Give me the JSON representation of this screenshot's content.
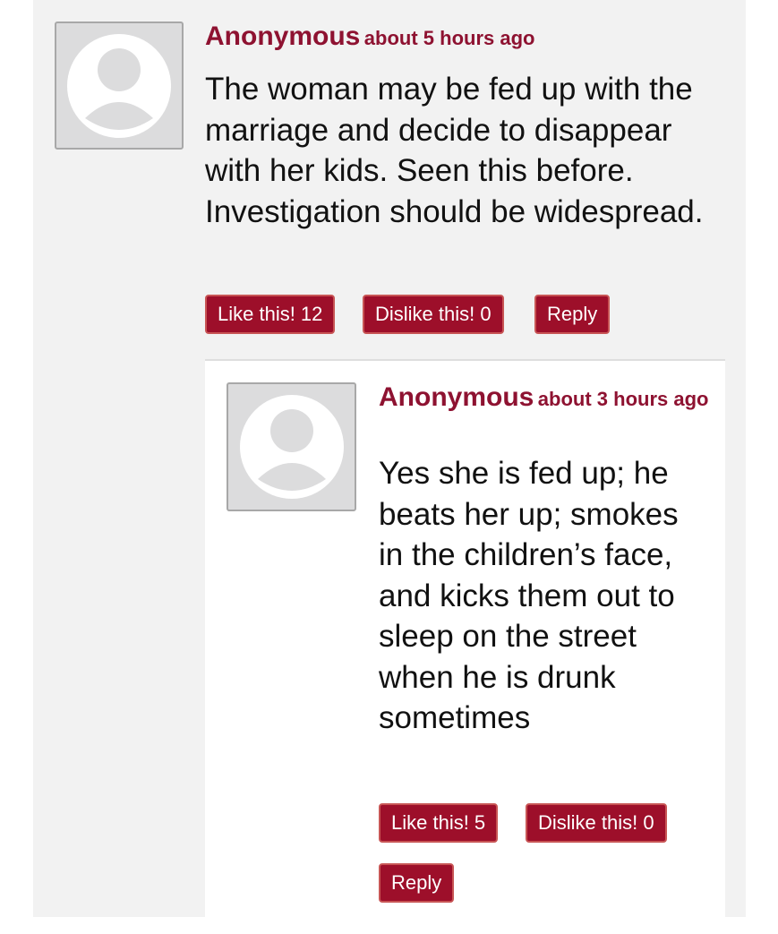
{
  "comments": [
    {
      "author": "Anonymous",
      "time": "about 5 hours ago",
      "body": "The woman may be fed up with the marriage and decide to disappear with her kids. Seen this before. Investigation should be widespread.",
      "like_label": "Like this! 12",
      "dislike_label": "Dislike this! 0",
      "reply_label": "Reply"
    },
    {
      "author": "Anonymous",
      "time": "about 3 hours ago",
      "body": "Yes she is fed up; he beats her up; smokes in the children’s face, and kicks them out to sleep on the street when he is drunk sometimes",
      "like_label": "Like this! 5",
      "dislike_label": "Dislike this! 0",
      "reply_label": "Reply"
    }
  ],
  "icons": {
    "avatar": "default-user-avatar-icon"
  },
  "colors": {
    "accent": "#8e1231",
    "button_bg": "#9d0f2a",
    "page_bg": "#f2f2f2"
  }
}
